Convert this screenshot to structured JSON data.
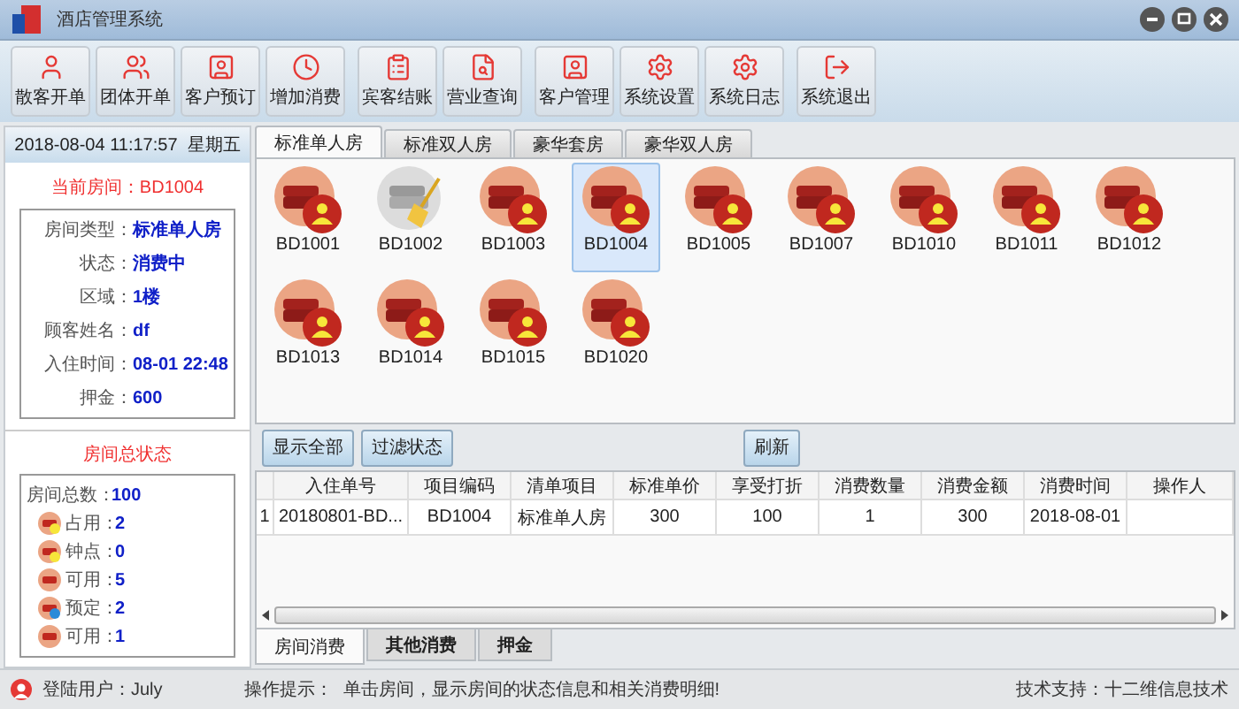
{
  "window": {
    "title": "酒店管理系统"
  },
  "toolbar": [
    "散客开单",
    "团体开单",
    "客户预订",
    "增加消费",
    "宾客结账",
    "营业查询",
    "客户管理",
    "系统设置",
    "系统日志",
    "系统退出"
  ],
  "datetime": "2018-08-04 11:17:57  星期五",
  "current_room": {
    "title": "当前房间：BD1004",
    "fields": [
      {
        "label": "房间类型：",
        "value": "标准单人房"
      },
      {
        "label": "状态：",
        "value": "消费中"
      },
      {
        "label": "区域：",
        "value": "1楼"
      },
      {
        "label": "顾客姓名：",
        "value": "df"
      },
      {
        "label": "入住时间：",
        "value": "08-01 22:48"
      },
      {
        "label": "押金：",
        "value": "600"
      }
    ]
  },
  "room_status": {
    "title": "房间总状态",
    "total_label": "房间总数：",
    "total": "100",
    "items": [
      {
        "kind": "occupied",
        "label": "占用：",
        "value": "2"
      },
      {
        "kind": "hourly",
        "label": "钟点：",
        "value": "0"
      },
      {
        "kind": "available",
        "label": "可用：",
        "value": "5"
      },
      {
        "kind": "reserved",
        "label": "预定：",
        "value": "2"
      },
      {
        "kind": "available",
        "label": "可用：",
        "value": "1"
      }
    ]
  },
  "room_tabs": [
    {
      "label": "标准单人房",
      "selected": true
    },
    {
      "label": "标准双人房",
      "selected": false
    },
    {
      "label": "豪华套房",
      "selected": false
    },
    {
      "label": "豪华双人房",
      "selected": false
    }
  ],
  "rooms": [
    {
      "name": "BD1001",
      "kind": "occupied",
      "selected": false
    },
    {
      "name": "BD1002",
      "kind": "cleaning",
      "selected": false
    },
    {
      "name": "BD1003",
      "kind": "occupied",
      "selected": false
    },
    {
      "name": "BD1004",
      "kind": "occupied",
      "selected": true
    },
    {
      "name": "BD1005",
      "kind": "occupied",
      "selected": false
    },
    {
      "name": "BD1007",
      "kind": "occupied",
      "selected": false
    },
    {
      "name": "BD1010",
      "kind": "occupied",
      "selected": false
    },
    {
      "name": "BD1011",
      "kind": "occupied",
      "selected": false
    },
    {
      "name": "BD1012",
      "kind": "occupied",
      "selected": false
    },
    {
      "name": "BD1013",
      "kind": "occupied",
      "selected": false
    },
    {
      "name": "BD1014",
      "kind": "occupied",
      "selected": false
    },
    {
      "name": "BD1015",
      "kind": "occupied",
      "selected": false
    },
    {
      "name": "BD1020",
      "kind": "occupied",
      "selected": false
    }
  ],
  "actions": [
    "显示全部",
    "过滤状态"
  ],
  "refresh": "刷新",
  "table": {
    "columns": [
      "入住单号",
      "项目编码",
      "清单项目",
      "标准单价",
      "享受打折",
      "消费数量",
      "消费金额",
      "消费时间",
      "操作人"
    ],
    "rows": [
      {
        "index": "1",
        "cells": [
          "20180801-BD...",
          "BD1004",
          "标准单人房",
          "300",
          "100",
          "1",
          "300",
          "2018-08-01",
          ""
        ]
      }
    ]
  },
  "bottom_tabs": [
    {
      "label": "房间消费",
      "selected": true
    },
    {
      "label": "其他消费",
      "selected": false
    },
    {
      "label": "押金",
      "selected": false
    }
  ],
  "status_bar": {
    "user": "登陆用户：July",
    "hint_label": "操作提示：",
    "hint": "单击房间，显示房间的状态信息和相关消费明细!",
    "support": "技术支持：十二维信息技术"
  }
}
